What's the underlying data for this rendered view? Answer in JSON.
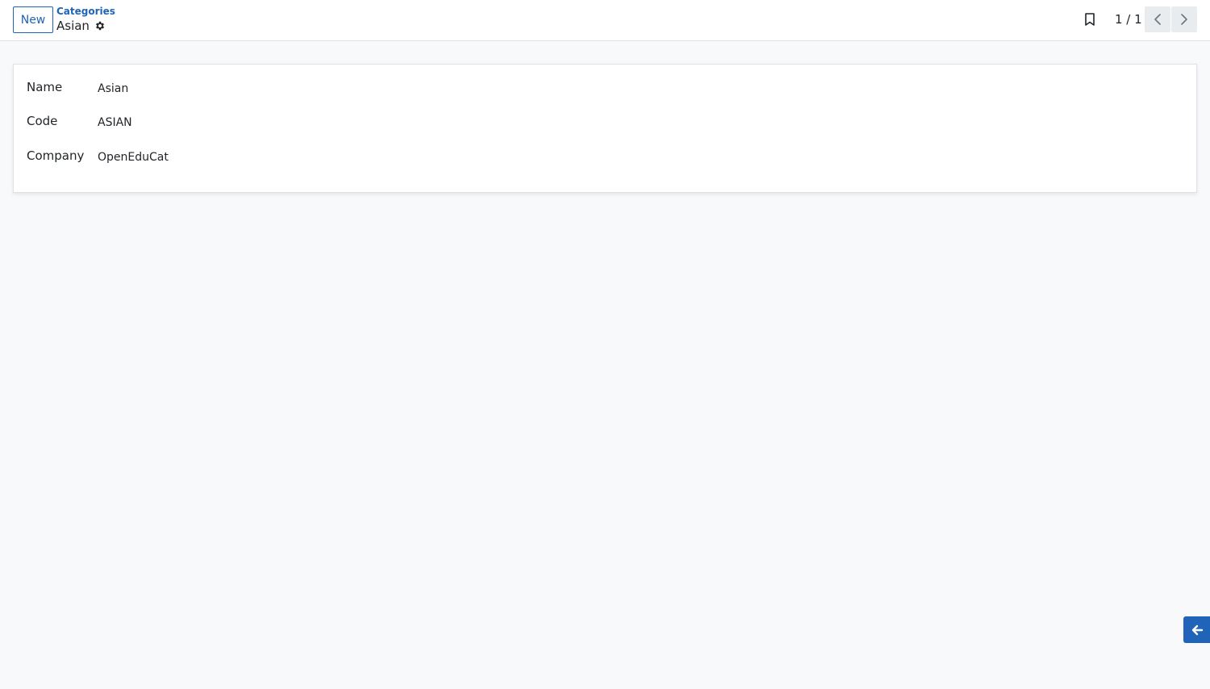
{
  "control_panel": {
    "new_button_label": "New",
    "breadcrumb_parent": "Categories",
    "breadcrumb_current": "Asian",
    "pager_value": "1 / 1"
  },
  "form": {
    "fields": [
      {
        "label": "Name",
        "value": "Asian"
      },
      {
        "label": "Code",
        "value": "ASIAN"
      },
      {
        "label": "Company",
        "value": "OpenEduCat"
      }
    ]
  },
  "icons": {
    "gear": "gear-icon",
    "bookmark": "bookmark-icon",
    "prev": "chevron-left-icon",
    "next": "chevron-right-icon",
    "side_toggle": "arrow-left-icon"
  },
  "colors": {
    "accent": "#1f64b8",
    "background": "#f8f9fa",
    "text": "#212529"
  }
}
